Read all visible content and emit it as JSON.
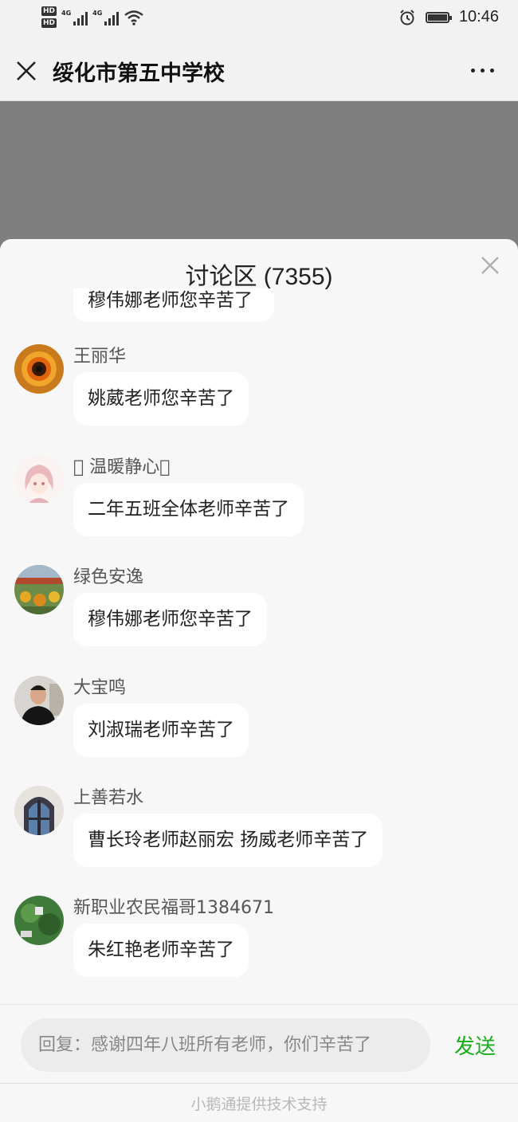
{
  "status_bar": {
    "hd1": "HD",
    "hd2": "HD",
    "net1": "4G",
    "net2": "4G",
    "time": "10:46",
    "icons": [
      "signal-icon",
      "wifi-icon",
      "alarm-icon",
      "battery-icon"
    ]
  },
  "header": {
    "title": "绥化市第五中学校",
    "close_icon": "close-icon",
    "more_icon": "more-icon"
  },
  "discussion": {
    "title": "讨论区 (7355)",
    "partial_message": "穆伟娜老师您辛苦了",
    "messages": [
      {
        "name": "王丽华",
        "text": "姚葳老师您辛苦了"
      },
      {
        "name": "\u0000 温暖静心\u0000",
        "text": "二年五班全体老师辛苦了"
      },
      {
        "name": "绿色安逸",
        "text": "穆伟娜老师您辛苦了"
      },
      {
        "name": "大宝鸣",
        "text": "刘淑瑞老师辛苦了"
      },
      {
        "name": "上善若水",
        "text": "曹长玲老师赵丽宏 扬威老师辛苦了"
      },
      {
        "name": "新职业农民福哥1384671",
        "text": "朱红艳老师辛苦了"
      }
    ]
  },
  "reply": {
    "value": "回复：感谢四年八班所有老师，你们辛苦了",
    "send_label": "发送"
  },
  "footer": {
    "powered_by": "小鹅通提供技术支持"
  },
  "colors": {
    "accent_green": "#1aad19",
    "overlay_gray": "#7f7f7f",
    "sheet_bg": "#f7f7f7"
  }
}
